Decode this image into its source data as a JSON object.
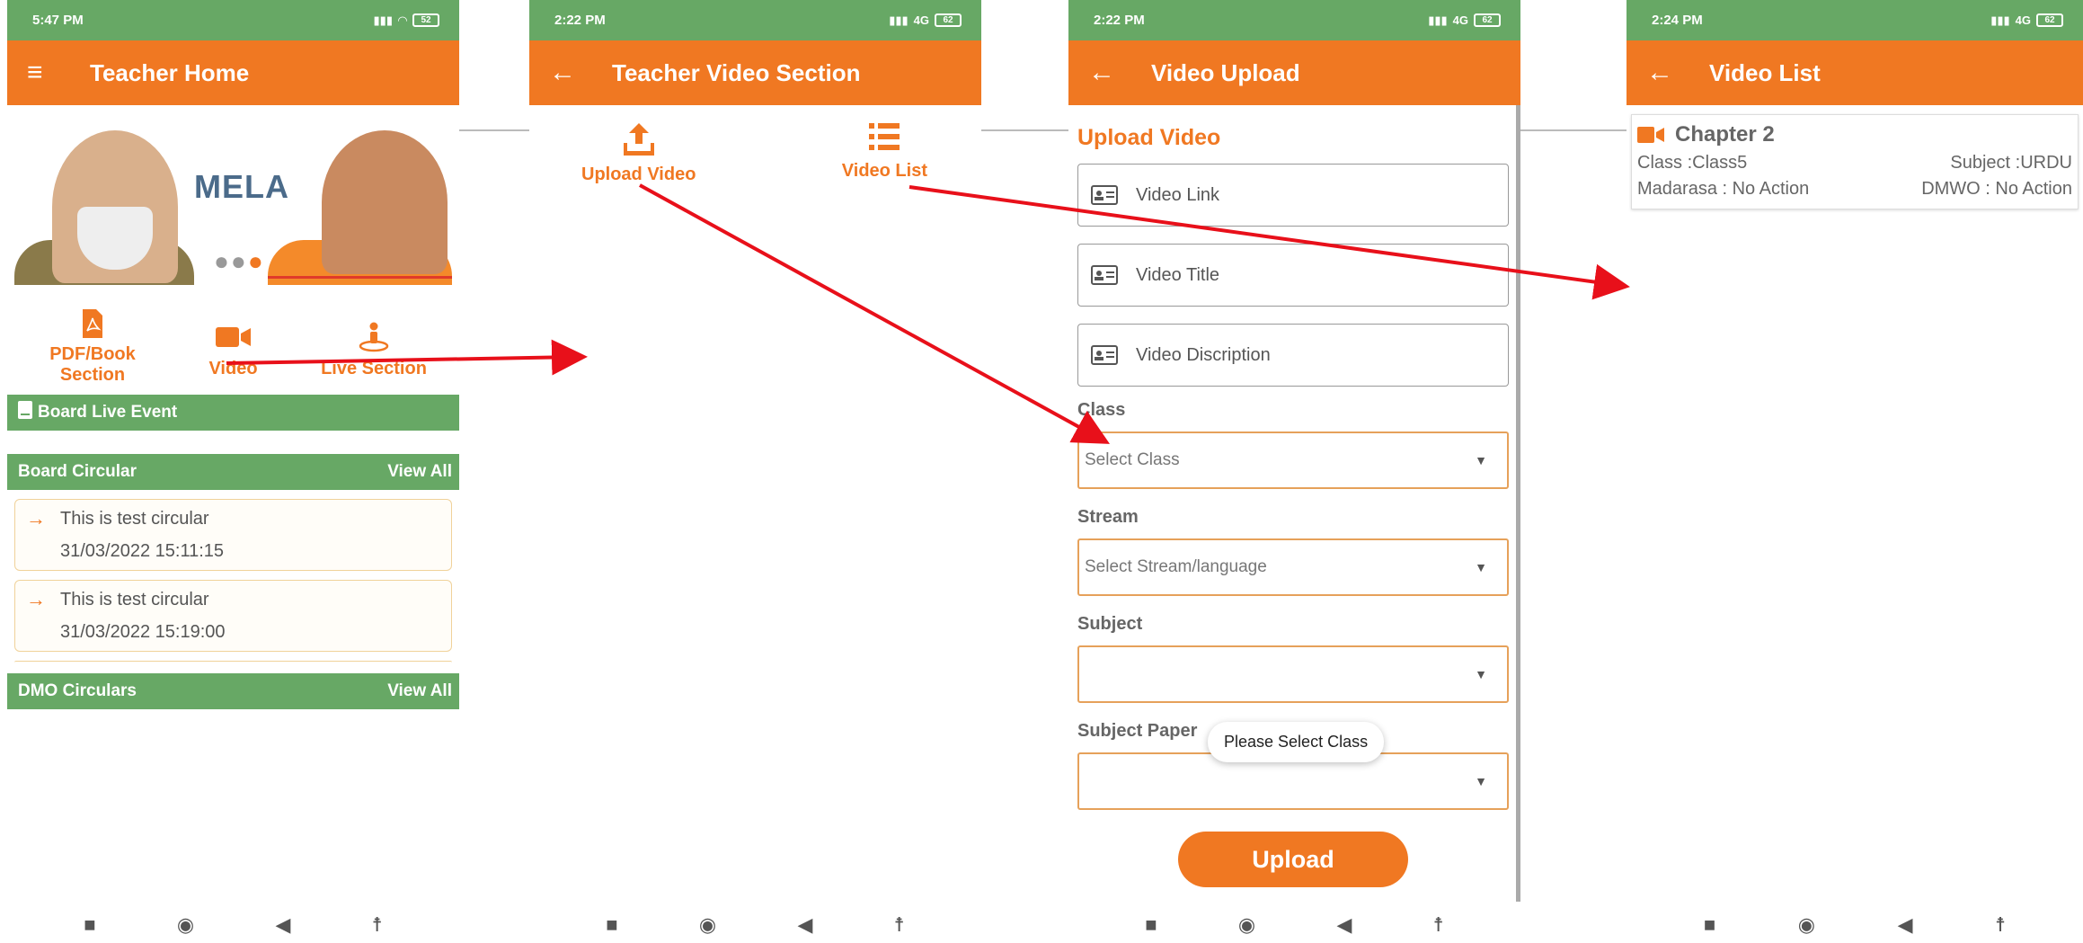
{
  "screens": [
    {
      "status_time": "5:47 PM",
      "battery": "52",
      "title": "Teacher Home",
      "banner_text": "MELA",
      "menu": [
        "PDF/Book Section",
        "Video",
        "Live Section"
      ],
      "live_event": "Board Live Event",
      "board_circular": "Board Circular",
      "view_all": "View All",
      "circulars": [
        {
          "title": "This is test circular",
          "date": "31/03/2022 15:11:15"
        },
        {
          "title": "This is test circular",
          "date": "31/03/2022 15:19:00"
        }
      ],
      "dmo_circulars": "DMO Circulars"
    },
    {
      "status_time": "2:22 PM",
      "network": "4G",
      "battery": "62",
      "title": "Teacher Video Section",
      "upload_video": "Upload Video",
      "video_list": "Video List"
    },
    {
      "status_time": "2:22 PM",
      "network": "4G",
      "battery": "62",
      "title": "Video Upload",
      "heading": "Upload Video",
      "fields": [
        "Video Link",
        "Video Title",
        "Video Discription"
      ],
      "class_label": "Class",
      "class_placeholder": "Select Class",
      "stream_label": "Stream",
      "stream_placeholder": "Select Stream/language",
      "subject_label": "Subject",
      "subject_paper_label": "Subject Paper",
      "toast": "Please Select Class",
      "upload_button": "Upload"
    },
    {
      "status_time": "2:24 PM",
      "network": "4G",
      "battery": "62",
      "title": "Video List",
      "videos": [
        {
          "name": "Chapter 2",
          "class": "Class :Class5",
          "subject": "Subject :URDU",
          "madarasa": "Madarasa : No Action",
          "dmwo": "DMWO : No Action"
        }
      ]
    }
  ],
  "colors": {
    "status_green": "#67a865",
    "app_orange": "#f07822",
    "arrow_red": "#e8101a"
  },
  "icons": [
    "menu-icon",
    "back-arrow-icon",
    "pdf-icon",
    "video-camera-icon",
    "live-person-icon",
    "book-icon",
    "arrow-right-icon",
    "upload-icon",
    "list-icon",
    "id-card-icon",
    "dropdown-caret-icon"
  ]
}
